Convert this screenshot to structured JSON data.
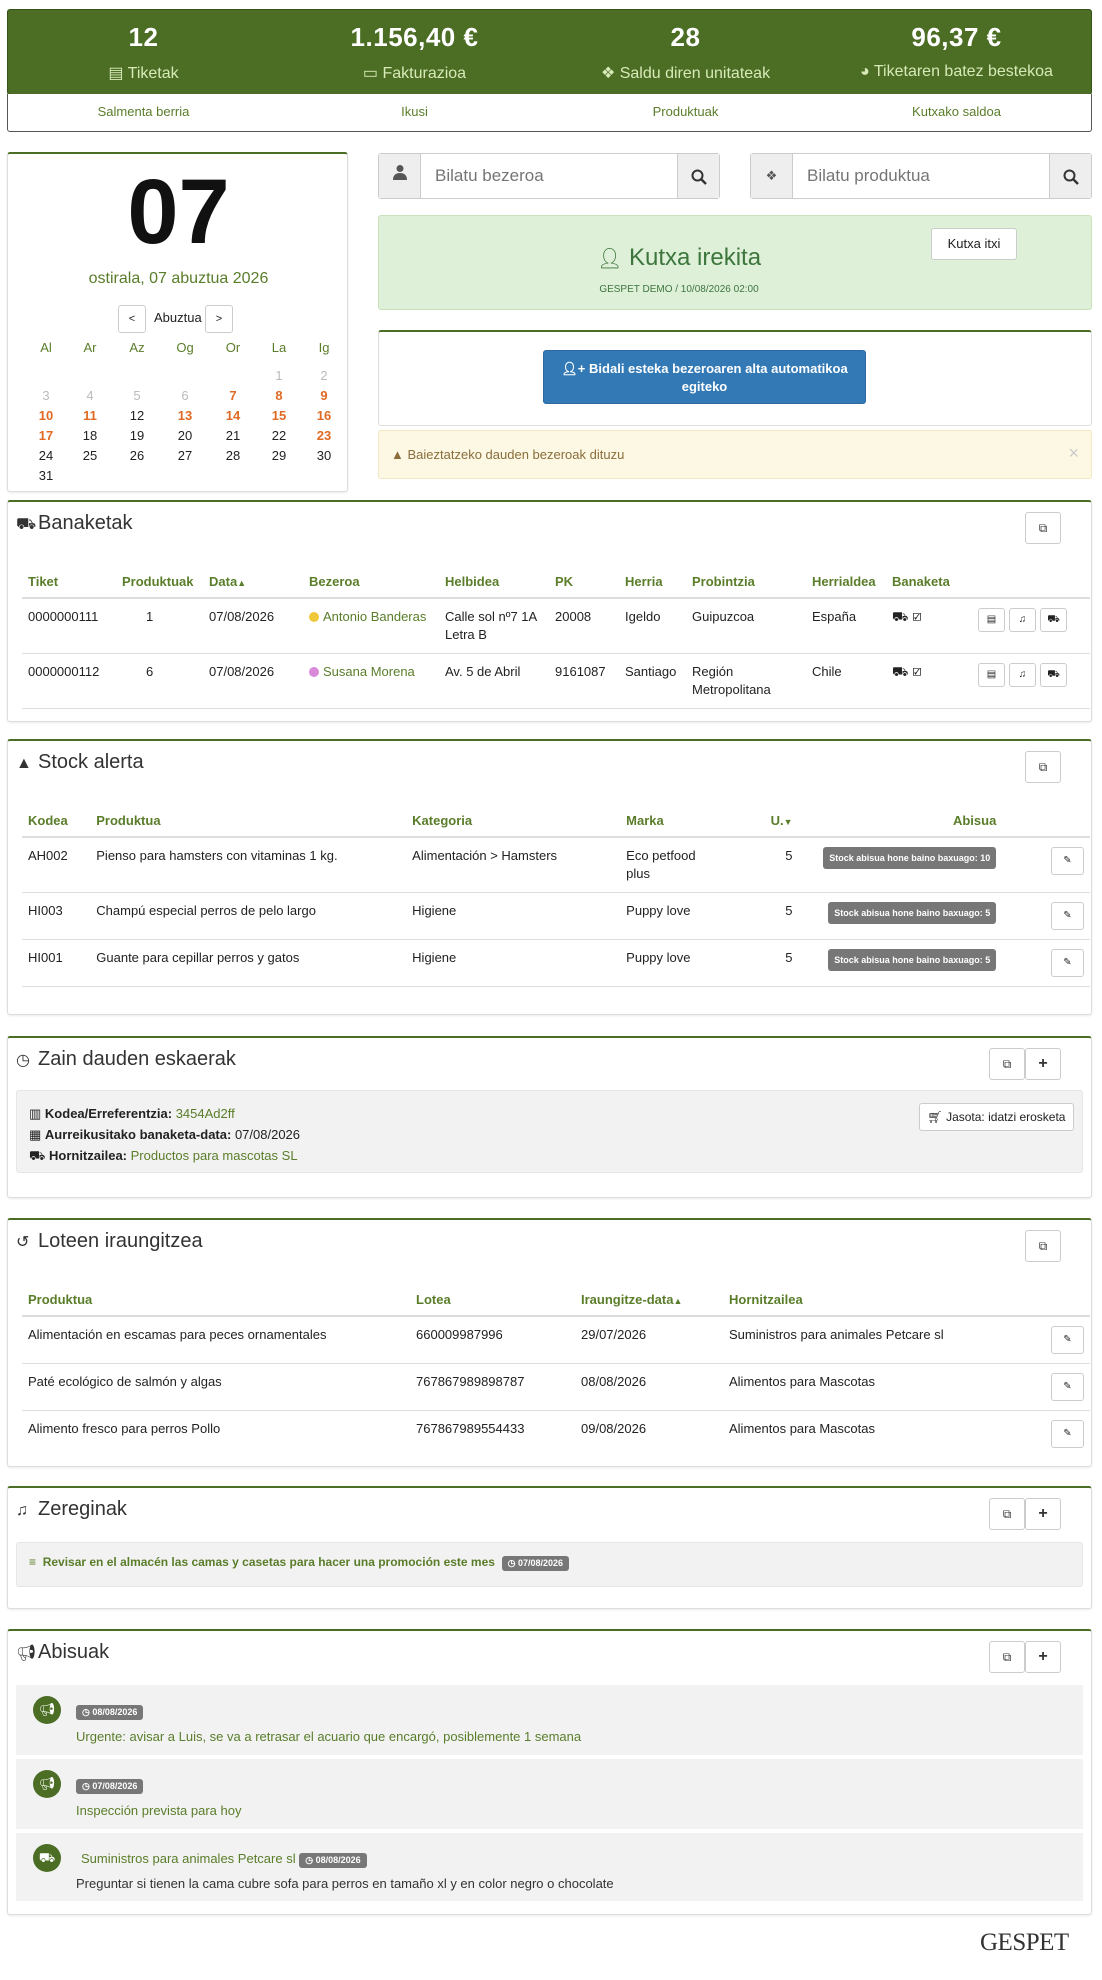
{
  "stats": [
    {
      "value": "12",
      "label": "Tiketak",
      "icon": "file-icon"
    },
    {
      "value": "1.156,40 €",
      "label": "Fakturazioa",
      "icon": "money-icon"
    },
    {
      "value": "28",
      "label": "Saldu diren unitateak",
      "icon": "dropbox-icon"
    },
    {
      "value": "96,37 €",
      "label": "Tiketaren batez bestekoa",
      "icon": "pie-chart-icon"
    }
  ],
  "nav": [
    "Salmenta berria",
    "Ikusi",
    "Produktuak",
    "Kutxako saldoa"
  ],
  "calendar": {
    "day": "07",
    "date": "ostirala, 07 abuztua 2026",
    "month": "Abuztua",
    "prev": "<",
    "next": ">",
    "weekdays": [
      "Al",
      "Ar",
      "Az",
      "Og",
      "Or",
      "La",
      "Ig"
    ],
    "weeks": [
      [
        [
          "",
          ""
        ],
        [
          "",
          ""
        ],
        [
          "",
          ""
        ],
        [
          "",
          ""
        ],
        [
          "",
          ""
        ],
        [
          "1",
          "muted"
        ],
        [
          "2",
          "muted"
        ]
      ],
      [
        [
          "3",
          "muted"
        ],
        [
          "4",
          "muted"
        ],
        [
          "5",
          "muted"
        ],
        [
          "6",
          "muted"
        ],
        [
          "7",
          "we"
        ],
        [
          "8",
          "we"
        ],
        [
          "9",
          "we"
        ]
      ],
      [
        [
          "10",
          "we"
        ],
        [
          "11",
          "we"
        ],
        [
          "12",
          ""
        ],
        [
          "13",
          "we"
        ],
        [
          "14",
          "we"
        ],
        [
          "15",
          "we"
        ],
        [
          "16",
          "we"
        ]
      ],
      [
        [
          "17",
          "we"
        ],
        [
          "18",
          ""
        ],
        [
          "19",
          ""
        ],
        [
          "20",
          ""
        ],
        [
          "21",
          ""
        ],
        [
          "22",
          ""
        ],
        [
          "23",
          "we"
        ]
      ],
      [
        [
          "24",
          ""
        ],
        [
          "25",
          ""
        ],
        [
          "26",
          ""
        ],
        [
          "27",
          ""
        ],
        [
          "28",
          ""
        ],
        [
          "29",
          ""
        ],
        [
          "30",
          ""
        ]
      ],
      [
        [
          "31",
          ""
        ],
        [
          "",
          ""
        ],
        [
          "",
          ""
        ],
        [
          "",
          ""
        ],
        [
          "",
          ""
        ],
        [
          "",
          ""
        ],
        [
          "",
          ""
        ]
      ]
    ]
  },
  "search": {
    "customer_placeholder": "Bilatu bezeroa",
    "product_placeholder": "Bilatu produktua"
  },
  "cashbox": {
    "title": "Kutxa irekita",
    "subtitle": "GESPET DEMO / 10/08/2026 02:00",
    "close_label": "Kutxa itxi"
  },
  "signup": {
    "label": "Bidali esteka bezeroaren alta automatikoa egiteko"
  },
  "warning": {
    "text": "Baieztatzeko dauden bezeroak dituzu",
    "close": "×"
  },
  "deliveries": {
    "title": "Banaketak",
    "headers": [
      "Tiket",
      "Produktuak",
      "Data",
      "Bezeroa",
      "Helbidea",
      "PK",
      "Herria",
      "Probintzia",
      "Herrialdea",
      "Banaketa"
    ],
    "rows": [
      {
        "tiket": "0000000111",
        "products": "1",
        "date": "07/08/2026",
        "customer": "Antonio Banderas",
        "color": "#f0c93a",
        "address": "Calle sol nº7 1A Letra B",
        "pk": "20008",
        "town": "Igeldo",
        "province": "Guipuzcoa",
        "country": "España"
      },
      {
        "tiket": "0000000112",
        "products": "6",
        "date": "07/08/2026",
        "customer": "Susana Morena",
        "color": "#d88ad8",
        "address": "Av. 5 de Abril",
        "pk": "9161087",
        "town": "Santiago",
        "province": "Región Metropolitana",
        "country": "Chile"
      }
    ]
  },
  "stock": {
    "title": "Stock alerta",
    "headers": [
      "Kodea",
      "Produktua",
      "Kategoria",
      "Marka",
      "U.",
      "Abisua"
    ],
    "rows": [
      {
        "code": "AH002",
        "product": "Pienso para hamsters con vitaminas 1 kg.",
        "category": "Alimentación > Hamsters",
        "brand": "Eco petfood plus",
        "units": "5",
        "alert": "Stock abisua hone baino baxuago: 10"
      },
      {
        "code": "HI003",
        "product": "Champú especial perros de pelo largo",
        "category": "Higiene",
        "brand": "Puppy love",
        "units": "5",
        "alert": "Stock abisua hone baino baxuago: 5"
      },
      {
        "code": "HI001",
        "product": "Guante para cepillar perros y gatos",
        "category": "Higiene",
        "brand": "Puppy love",
        "units": "5",
        "alert": "Stock abisua hone baino baxuago: 5"
      }
    ]
  },
  "orders": {
    "title": "Zain dauden eskaerak",
    "code_label": "Kodea/Erreferentzia:",
    "code_value": "3454Ad2ff",
    "date_label": "Aurreikusitako banaketa-data:",
    "date_value": "07/08/2026",
    "supplier_label": "Hornitzailea:",
    "supplier_value": "Productos para mascotas SL",
    "received_label": "Jasota: idatzi erosketa"
  },
  "lots": {
    "title": "Loteen iraungitzea",
    "headers": [
      "Produktua",
      "Lotea",
      "Iraungitze-data",
      "Hornitzailea"
    ],
    "rows": [
      {
        "product": "Alimentación en escamas para peces ornamentales",
        "lot": "660009987996",
        "date": "29/07/2026",
        "supplier": "Suministros para animales Petcare sl"
      },
      {
        "product": "Paté ecológico de salmón y algas",
        "lot": "767867989898787",
        "date": "08/08/2026",
        "supplier": "Alimentos para Mascotas"
      },
      {
        "product": "Alimento fresco para perros Pollo",
        "lot": "767867989554433",
        "date": "09/08/2026",
        "supplier": "Alimentos para Mascotas"
      }
    ]
  },
  "tasks": {
    "title": "Zereginak",
    "items": [
      {
        "text": "Revisar en el almacén las camas y casetas para hacer una promoción este mes",
        "date": "07/08/2026"
      }
    ]
  },
  "notices": {
    "title": "Abisuak",
    "items": [
      {
        "date": "08/08/2026",
        "text": "Urgente: avisar a Luis, se va a retrasar el acuario que encargó, posiblemente 1 semana",
        "icon": "bullhorn-icon"
      },
      {
        "date": "07/08/2026",
        "text": "Inspección prevista para hoy",
        "icon": "bullhorn-icon"
      },
      {
        "supplier": "Suministros para animales Petcare sl",
        "date": "08/08/2026",
        "text": "Preguntar si tienen la cama cubre sofa para perros en tamaño xl y en color negro o chocolate",
        "icon": "truck-icon"
      }
    ]
  },
  "brand": "GESPET",
  "colors": {
    "primary": "#4b6d24",
    "accent_text": "#5a7d2a",
    "weekend": "#e06a23",
    "button_blue": "#3279b6"
  }
}
